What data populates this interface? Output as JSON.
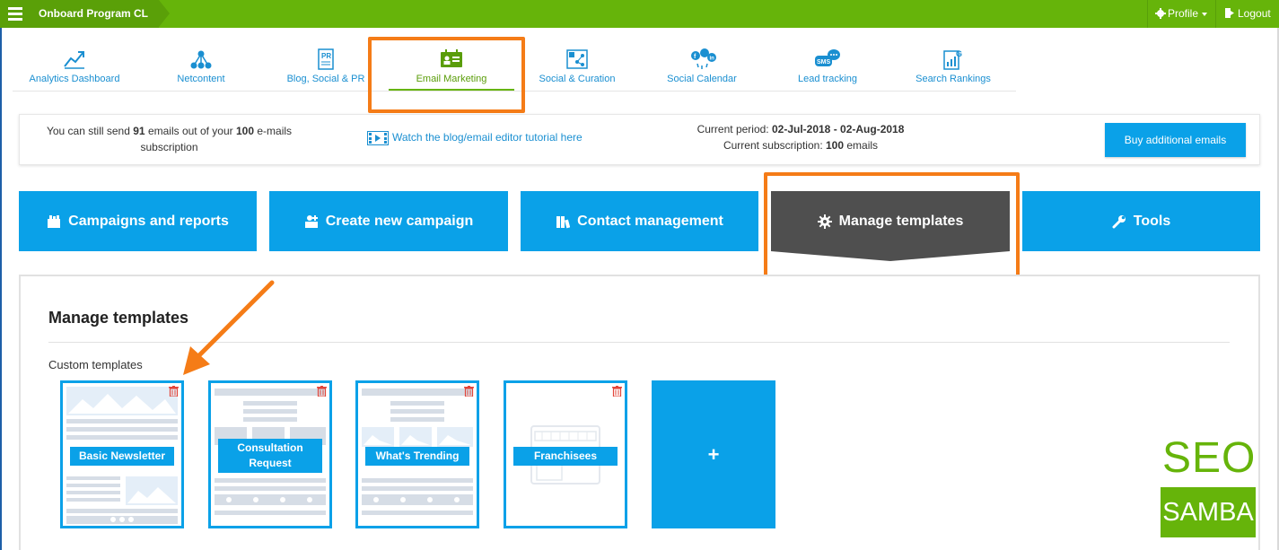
{
  "topbar": {
    "breadcrumb": "Onboard Program CL",
    "profile_label": "Profile",
    "logout_label": "Logout",
    "color": "#66b40a"
  },
  "nav": {
    "items": [
      {
        "label": "Analytics Dashboard",
        "icon": "line-chart-icon"
      },
      {
        "label": "Netcontent",
        "icon": "network-icon"
      },
      {
        "label": "Blog, Social & PR",
        "icon": "pr-document-icon"
      },
      {
        "label": "Email Marketing",
        "icon": "email-card-icon",
        "active": true
      },
      {
        "label": "Social & Curation",
        "icon": "curation-icon"
      },
      {
        "label": "Social Calendar",
        "icon": "social-networks-icon"
      },
      {
        "label": "Lead tracking",
        "icon": "sms-chat-icon"
      },
      {
        "label": "Search Rankings",
        "icon": "rankings-icon"
      }
    ]
  },
  "info": {
    "send_pre": "You can still send",
    "send_count": "91",
    "send_mid": "emails out of your",
    "send_total": "100",
    "send_post": "e-mails",
    "send_line2": "subscription",
    "tutorial_link": "Watch the blog/email editor tutorial here",
    "period_label": "Current period:",
    "period_value": "02-Jul-2018 - 02-Aug-2018",
    "subscription_label": "Current subscription:",
    "subscription_value": "100",
    "subscription_unit": "emails",
    "buy_button": "Buy additional emails"
  },
  "actions": [
    {
      "label": "Campaigns and reports",
      "icon": "reports-icon"
    },
    {
      "label": "Create new campaign",
      "icon": "create-campaign-icon"
    },
    {
      "label": "Contact management",
      "icon": "contacts-icon"
    },
    {
      "label": "Manage templates",
      "icon": "gear-icon",
      "active": true
    },
    {
      "label": "Tools",
      "icon": "wrench-icon"
    }
  ],
  "main": {
    "title": "Manage templates",
    "custom_label": "Custom templates",
    "templates": [
      {
        "name": "Basic Newsletter"
      },
      {
        "name": "Consultation Request"
      },
      {
        "name": "What's Trending"
      },
      {
        "name": "Franchisees"
      }
    ],
    "add_label": "+"
  },
  "logo": {
    "line1": "SEO",
    "line2": "SAMBA"
  },
  "colors": {
    "accent_blue": "#0aa1e8",
    "brand_green": "#66b40a",
    "highlight_orange": "#f57c17",
    "active_tab_dark": "#4f4f4f"
  }
}
